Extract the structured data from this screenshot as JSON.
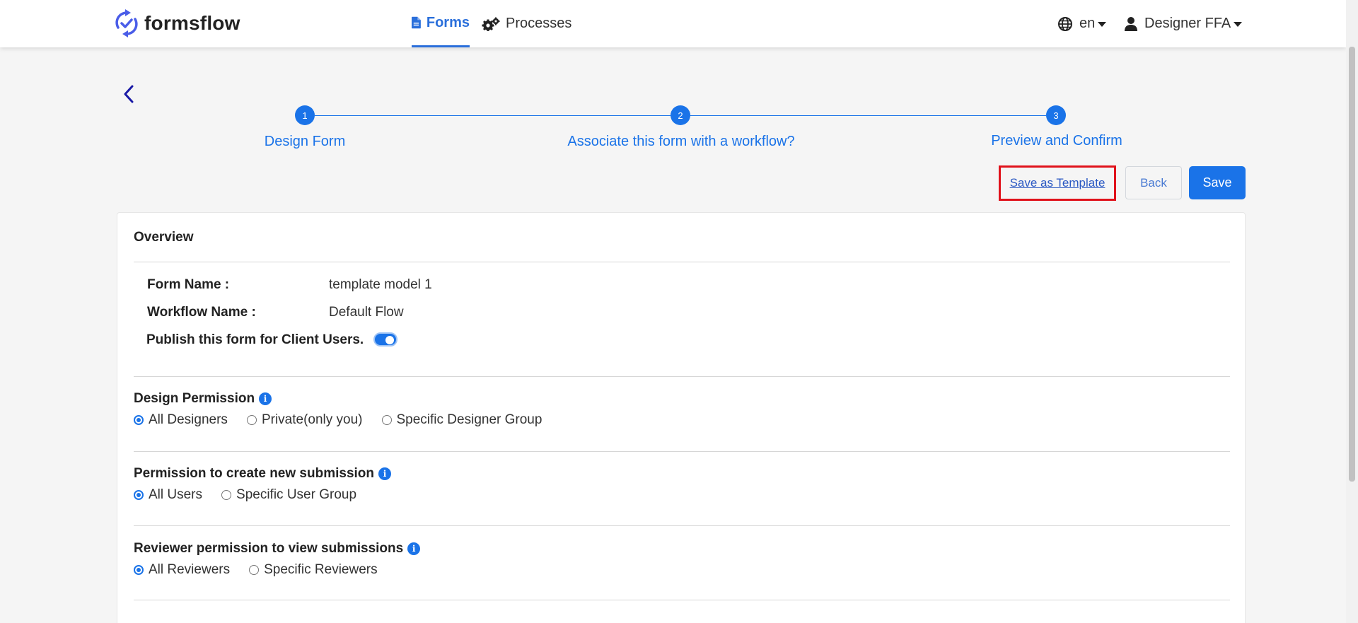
{
  "navbar": {
    "brand": "formsflow",
    "forms_label": "Forms",
    "processes_label": "Processes",
    "language": "en",
    "user_name": "Designer FFA"
  },
  "stepper": {
    "steps": [
      {
        "number": "1",
        "label": "Design Form"
      },
      {
        "number": "2",
        "label": "Associate this form with a workflow?"
      },
      {
        "number": "3",
        "label": "Preview and Confirm"
      }
    ]
  },
  "actions": {
    "save_as_template": "Save as Template",
    "back": "Back",
    "save": "Save"
  },
  "overview": {
    "title": "Overview",
    "form_name_label": "Form Name :",
    "form_name_value": "template model 1",
    "workflow_name_label": "Workflow Name :",
    "workflow_name_value": "Default Flow",
    "publish_label": "Publish this form for Client Users.",
    "publish_enabled": true
  },
  "design_permission": {
    "title": "Design Permission",
    "options": [
      "All Designers",
      "Private(only you)",
      "Specific Designer Group"
    ],
    "selected": "All Designers"
  },
  "submission_permission": {
    "title": "Permission to create new submission",
    "options": [
      "All Users",
      "Specific User Group"
    ],
    "selected": "All Users"
  },
  "reviewer_permission": {
    "title": "Reviewer permission to view submissions",
    "options": [
      "All Reviewers",
      "Specific Reviewers"
    ],
    "selected": "All Reviewers"
  },
  "colors": {
    "primary": "#1a73e8",
    "highlight_border": "#e0121b"
  }
}
